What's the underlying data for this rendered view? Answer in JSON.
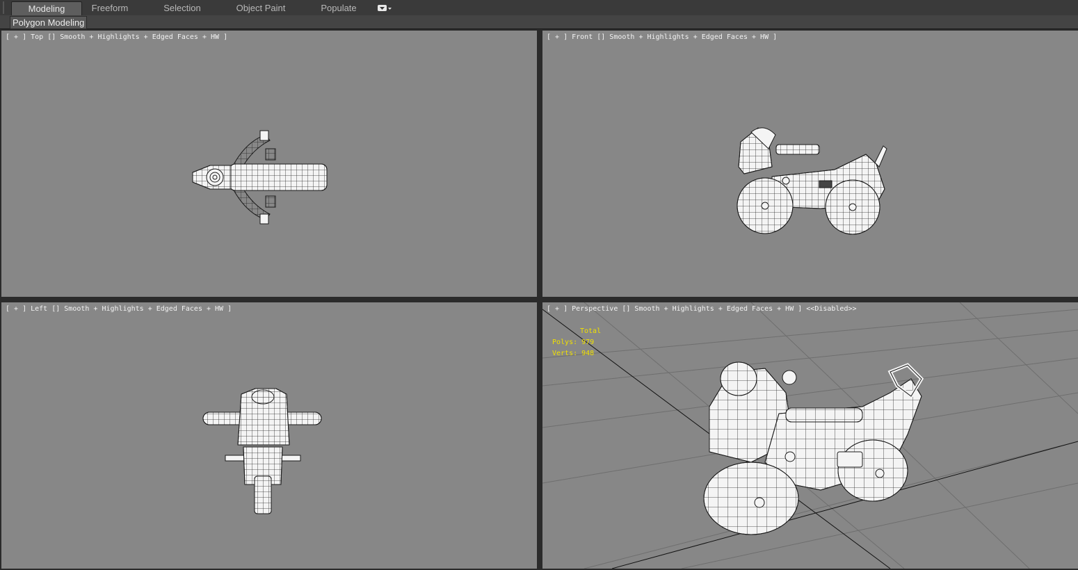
{
  "ribbon": {
    "tabs": [
      {
        "label": "Modeling",
        "active": true
      },
      {
        "label": "Freeform",
        "active": false
      },
      {
        "label": "Selection",
        "active": false
      },
      {
        "label": "Object Paint",
        "active": false
      },
      {
        "label": "Populate",
        "active": false
      }
    ],
    "panel_button": "Polygon Modeling"
  },
  "viewports": {
    "top": {
      "label": "[ + ] Top [] Smooth + Highlights + Edged Faces + HW ]"
    },
    "front": {
      "label": "[ + ] Front [] Smooth + Highlights + Edged Faces + HW ]"
    },
    "left": {
      "label": "[ + ] Left [] Smooth + Highlights + Edged Faces + HW ]"
    },
    "perspective": {
      "label": "[ + ] Perspective [] Smooth + Highlights + Edged Faces + HW ] <<Disabled>>",
      "stats": {
        "header": "Total",
        "polys": "Polys: 979",
        "verts": "Verts: 948"
      }
    }
  },
  "colors": {
    "viewport_bg": "#878787",
    "model": "#f4f4f4",
    "wire": "#1a1a1a",
    "stats_text": "#f0e000",
    "active_tab": "#5e5e5e"
  }
}
